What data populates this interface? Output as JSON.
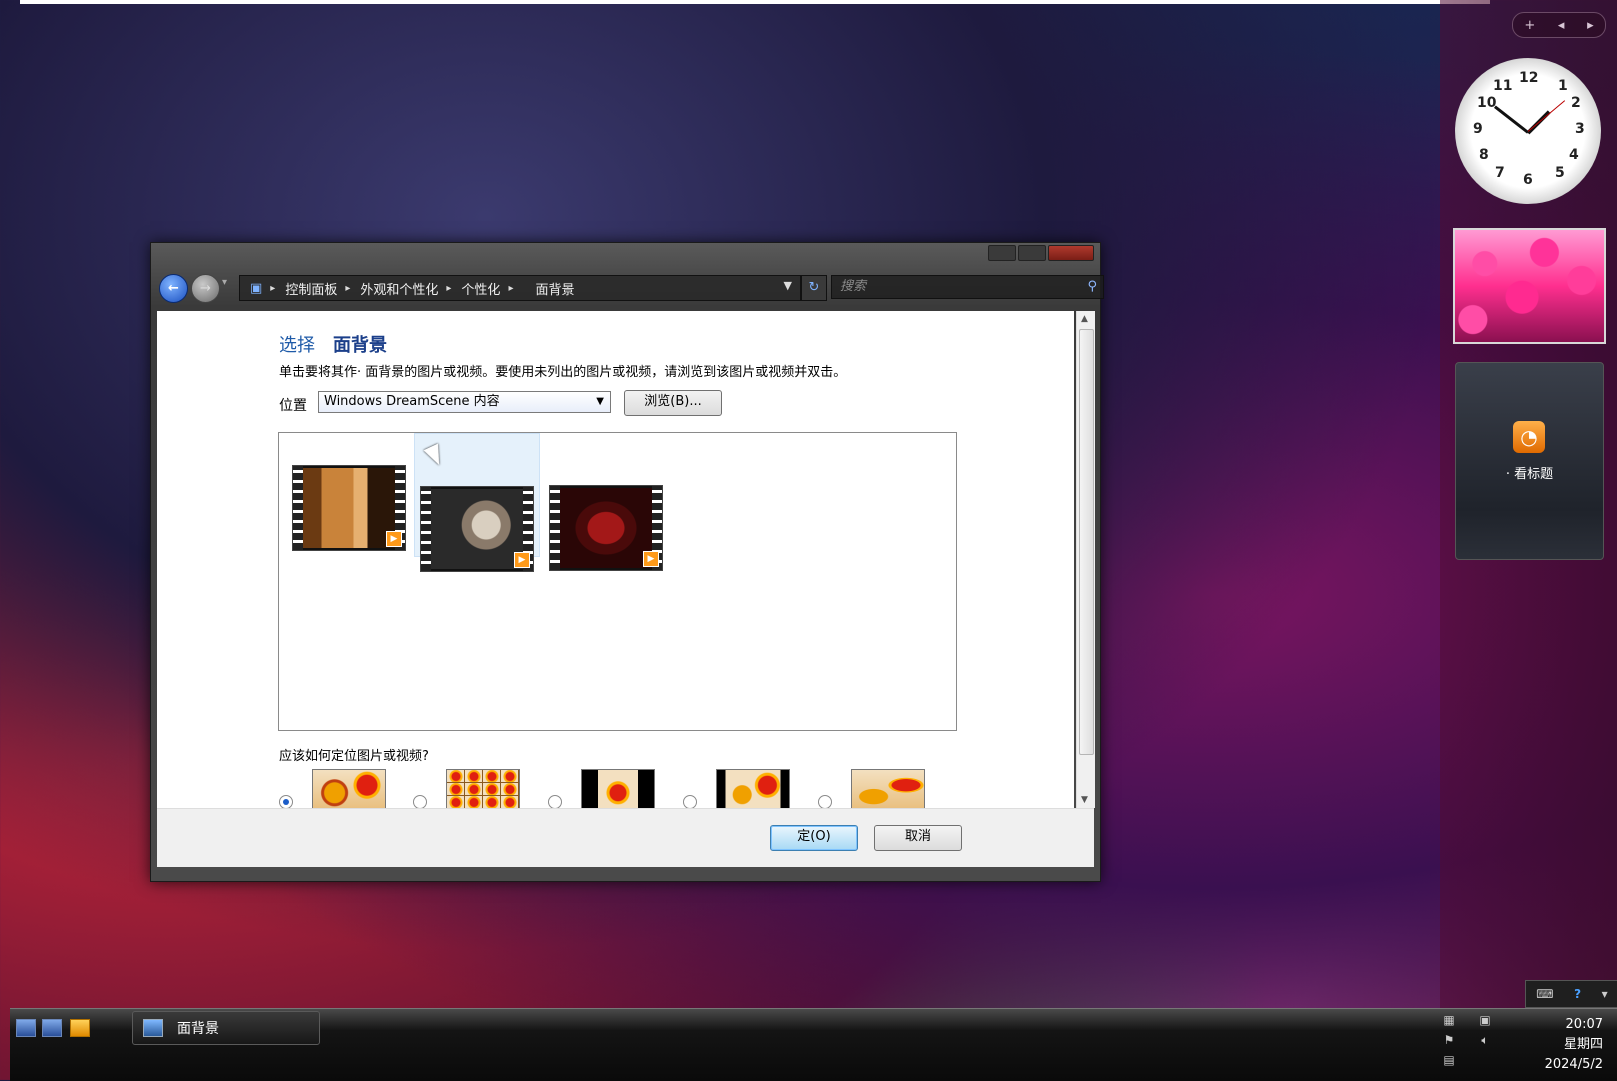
{
  "window": {
    "breadcrumbs": [
      "控制面板",
      "外观和个性化",
      "个性化",
      "面背景"
    ],
    "search_placeholder": "搜索",
    "title_prefix": "选择",
    "title_main": "面背景",
    "instruction": "单击要将其作· 面背景的图片或视频。要使用未列出的图片或视频，请浏览到该图片或视频并双击。",
    "location_label": "位置",
    "location_value": "Windows DreamScene 内容",
    "browse_button": "浏览(B)...",
    "position_question": "应该如何定位图片或视频?",
    "ok_button": "定(O)",
    "cancel_button": "取消",
    "selected_position_index": 0
  },
  "videos": [
    {
      "name": "video-thumbnail-1",
      "colors": [
        "#6b3a12",
        "#c9833a",
        "#2a1608"
      ]
    },
    {
      "name": "video-thumbnail-2",
      "colors": [
        "#2a2a2a",
        "#8a7a6a",
        "#d9cfc0"
      ]
    },
    {
      "name": "video-thumbnail-3",
      "colors": [
        "#2a0606",
        "#a31818",
        "#4a0a0a"
      ]
    }
  ],
  "sidebar": {
    "controls": [
      "+",
      "◂",
      "▸"
    ],
    "clock_numbers": [
      "12",
      "1",
      "2",
      "3",
      "4",
      "5",
      "6",
      "7",
      "8",
      "9",
      "10",
      "11"
    ],
    "rss_label": "· 看标题"
  },
  "taskbar": {
    "active_window": "面背景",
    "time": "20:07",
    "weekday": "星期四",
    "date": "2024/5/2"
  },
  "colors": {
    "accent": "#1e5aa8",
    "selection": "#e5f1fb"
  }
}
